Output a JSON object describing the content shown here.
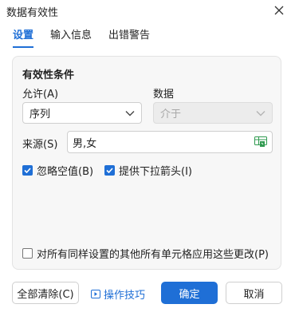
{
  "window": {
    "title": "数据有效性"
  },
  "tabs": [
    {
      "label": "设置"
    },
    {
      "label": "输入信息"
    },
    {
      "label": "出错警告"
    }
  ],
  "panel": {
    "section_title": "有效性条件",
    "allow": {
      "label": "允许(A)",
      "value": "序列"
    },
    "data": {
      "label": "数据",
      "value": "介于"
    },
    "source": {
      "label": "来源(S)",
      "value": "男,女"
    },
    "ignore_blank": {
      "label": "忽略空值(B)",
      "checked": true
    },
    "dropdown_arrow": {
      "label": "提供下拉箭头(I)",
      "checked": true
    },
    "apply_all": {
      "label": "对所有同样设置的其他所有单元格应用这些更改(P)",
      "checked": false
    }
  },
  "footer": {
    "clear_all": "全部清除(C)",
    "tips": "操作技巧",
    "ok": "确定",
    "cancel": "取消"
  },
  "colors": {
    "accent": "#1f6fd6",
    "panel_bg": "#f7f7f7",
    "source_icon": "#2f9a4f"
  }
}
